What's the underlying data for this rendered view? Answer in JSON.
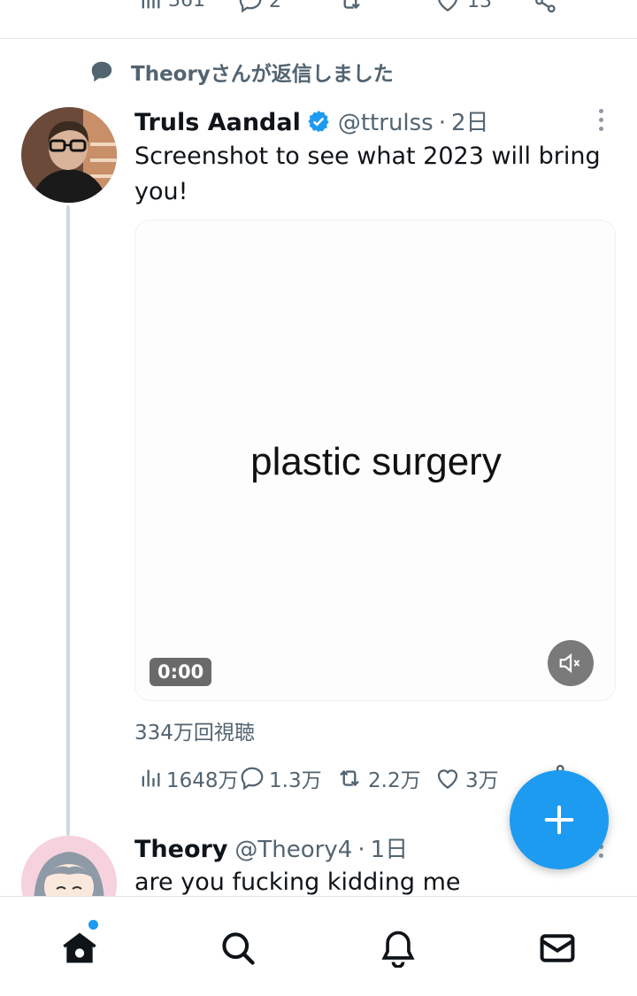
{
  "previous_tweet": {
    "views": "361",
    "replies": "2",
    "retweets": "",
    "likes": "13"
  },
  "context": {
    "text": "Theoryさんが返信しました"
  },
  "tweet": {
    "author_name": "Truls Aandal",
    "handle": "@ttrulss",
    "time": "2日",
    "text": "Screenshot to see what 2023 will bring you!",
    "media": {
      "caption": "plastic surgery",
      "timer": "0:00"
    },
    "view_count_text": "334万回視聴",
    "stats": {
      "views": "1648万",
      "replies": "1.3万",
      "retweets": "2.2万",
      "likes": "3万"
    }
  },
  "reply": {
    "author_name": "Theory",
    "handle": "@Theory4",
    "time": "1日",
    "text": "are you fucking kidding me"
  },
  "colors": {
    "accent": "#1d9bf0",
    "secondary_text": "#536471",
    "thread_line": "#cfd9de"
  },
  "icons": {
    "bottom_nav": [
      "home-icon",
      "search-icon",
      "bell-icon",
      "mail-icon"
    ],
    "actions": [
      "analytics-icon",
      "reply-icon",
      "retweet-icon",
      "like-icon",
      "share-icon"
    ],
    "fab": "plus-icon"
  }
}
